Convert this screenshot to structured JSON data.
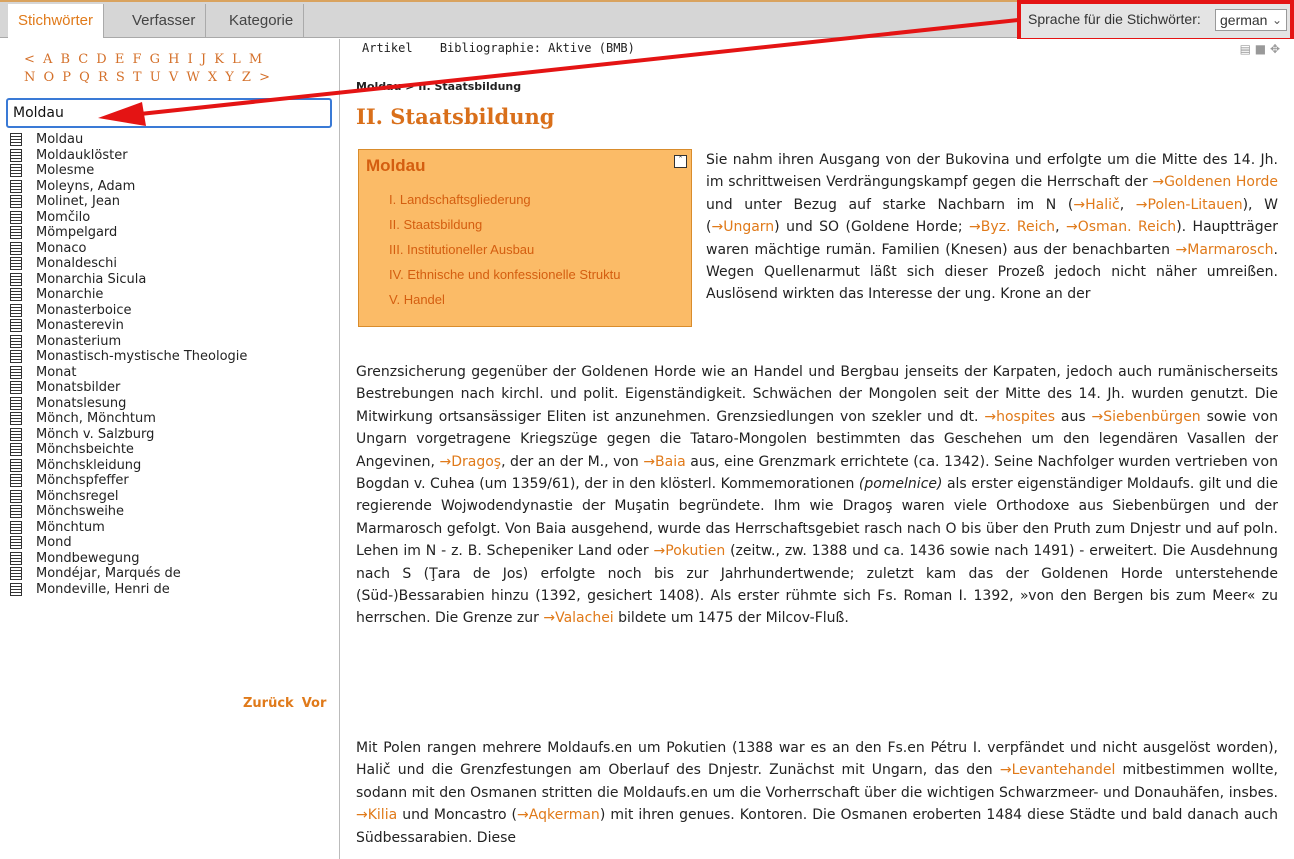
{
  "tabs": [
    {
      "label": "Stichwörter",
      "active": true
    },
    {
      "label": "Verfasser",
      "active": false
    },
    {
      "label": "Kategorie",
      "active": false
    }
  ],
  "language": {
    "label": "Sprache für die Stichwörter:",
    "value": "german"
  },
  "alphabet": {
    "row1": "< A B C D E F G H I J K L M",
    "row2": "N O P Q R S T U V W X Y Z >"
  },
  "search": {
    "value": "Moldau"
  },
  "entries": [
    "Moldau",
    "Moldauklöster",
    "Molesme",
    "Moleyns, Adam",
    "Molinet, Jean",
    "Momčilo",
    "Mömpelgard",
    "Monaco",
    "Monaldeschi",
    "Monarchia Sicula",
    "Monarchie",
    "Monasterboice",
    "Monasterevin",
    "Monasterium",
    "Monastisch-mystische Theologie",
    "Monat",
    "Monatsbilder",
    "Monatslesung",
    "Mönch, Mönchtum",
    "Mönch v. Salzburg",
    "Mönchsbeichte",
    "Mönchskleidung",
    "Mönchspfeffer",
    "Mönchsregel",
    "Mönchsweihe",
    "Mönchtum",
    "Mond",
    "Mondbewegung",
    "Mondéjar, Marqués de",
    "Mondeville, Henri de"
  ],
  "pager": {
    "back": "Zurück",
    "next": "Vor"
  },
  "subtabs": {
    "article": "Artikel",
    "bibliography": "Bibliographie: Aktive (BMB)"
  },
  "breadcrumb": "Moldau > II. Staatsbildung",
  "title": "II. Staatsbildung",
  "toc": {
    "title": "Moldau",
    "items": [
      "I. Landschaftsgliederung",
      "II. Staatsbildung",
      "III. Institutioneller Ausbau",
      "IV. Ethnische und konfessionelle Struktu",
      "V. Handel"
    ]
  },
  "body": {
    "p1": [
      {
        "t": "Sie nahm ihren Ausgang von der Bukovina und erfolgte um die Mitte des 14. Jh. im schrittweisen Verdrängungskampf gegen die Herrschaft der "
      },
      {
        "l": "→Goldenen Horde"
      },
      {
        "t": " und unter Bezug auf starke Nachbarn im N ("
      },
      {
        "l": "→Halič"
      },
      {
        "t": ", "
      },
      {
        "l": "→Polen-Litauen"
      },
      {
        "t": "), W ("
      },
      {
        "l": "→Ungarn"
      },
      {
        "t": ") und SO (Goldene Horde; "
      },
      {
        "l": "→Byz. Reich"
      },
      {
        "t": ", "
      },
      {
        "l": "→Osman. Reich"
      },
      {
        "t": "). Hauptträger waren mächtige rumän. Familien (Knesen) aus der benachbarten "
      },
      {
        "l": "→Marmarosch"
      },
      {
        "t": ". Wegen Quellenarmut läßt sich dieser Prozeß jedoch nicht näher umreißen. Auslösend wirkten das Interesse der ung. Krone an der"
      }
    ],
    "p2": [
      {
        "t": "Grenzsicherung gegenüber der Goldenen Horde wie an Handel und Bergbau jenseits der Karpaten, jedoch auch rumänischerseits Bestrebungen nach kirchl. und polit. Eigenständigkeit. Schwächen der Mongolen seit der Mitte des 14. Jh. wurden genutzt. Die Mitwirkung ortsansässiger Eliten ist anzunehmen. Grenzsiedlungen von szekler und dt. "
      },
      {
        "l": "→hospites"
      },
      {
        "t": " aus "
      },
      {
        "l": "→Siebenbürgen"
      },
      {
        "t": " sowie von Ungarn vorgetragene Kriegszüge gegen die Tataro-Mongolen bestimmten das Geschehen um den legendären Vasallen der Angevinen, "
      },
      {
        "l": "→Dragoş"
      },
      {
        "t": ", der an der M., von "
      },
      {
        "l": "→Baia"
      },
      {
        "t": " aus, eine Grenzmark errichtete (ca. 1342). Seine Nachfolger wurden vertrieben von Bogdan v. Cuhea (um 1359/61), der in den klösterl. Kommemorationen "
      },
      {
        "i": "(pomelnice)"
      },
      {
        "t": " als erster eigenständiger Moldaufs. gilt und die regierende Wojwodendynastie der Muşatin begründete. Ihm wie Dragoş waren viele Orthodoxe aus Siebenbürgen und der Marmarosch gefolgt. Von Baia ausgehend, wurde das Herrschaftsgebiet rasch nach O bis über den Pruth zum Dnjestr und auf poln. Lehen im N - z. B. Schepeniker Land oder "
      },
      {
        "l": "→Pokutien"
      },
      {
        "t": " (zeitw., zw. 1388 und ca. 1436 sowie nach 1491) - erweitert. Die Ausdehnung nach S (Ţara de Jos) erfolgte noch bis zur Jahrhundertwende; zuletzt kam das der Goldenen Horde unterstehende (Süd-)Bessarabien hinzu (1392, gesichert 1408). Als erster rühmte sich Fs. Roman I. 1392, »von den Bergen bis zum Meer« zu herrschen. Die Grenze zur "
      },
      {
        "l": "→Valachei"
      },
      {
        "t": " bildete um 1475 der Milcov-Fluß."
      }
    ],
    "p3": [
      {
        "t": "Mit Polen rangen mehrere Moldaufs.en um Pokutien (1388 war es an den Fs.en Pétru I. verpfändet und nicht ausgelöst worden), Halič und die Grenzfestungen am Oberlauf des Dnjestr. Zunächst mit Ungarn, das den "
      },
      {
        "l": "→Levantehandel"
      },
      {
        "t": " mitbestimmen wollte, sodann mit den Osmanen stritten die Moldaufs.en um die Vorherrschaft über die wichtigen Schwarzmeer- und Donauhäfen, insbes. "
      },
      {
        "l": "→Kilia"
      },
      {
        "t": " und Moncastro ("
      },
      {
        "l": "→Aqkerman"
      },
      {
        "t": ") mit ihren genues. Kontoren. Die Osmanen eroberten 1484 diese Städte und bald danach auch Südbessarabien. Diese"
      }
    ]
  },
  "colors": {
    "accent": "#e07a1a",
    "toc_bg": "#fbbb67",
    "highlight": "#e41414"
  }
}
